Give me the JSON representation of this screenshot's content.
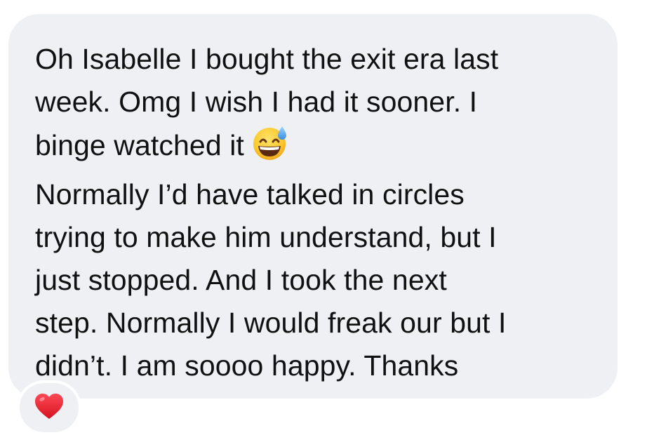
{
  "message": {
    "lines": [
      "Oh Isabelle I bought the exit era last",
      "week. Omg I wish I had it sooner. I",
      "binge watched it",
      "Normally I’d have talked in circles",
      "trying to make him understand, but I",
      "just stopped. And I took the next",
      "step. Normally I would freak our but I",
      "didn’t. I am soooo happy. Thanks"
    ],
    "emoji": "grinning-face-with-sweat-icon"
  },
  "reaction": {
    "icon": "red-heart-icon",
    "color": "#e0202e"
  },
  "colors": {
    "bubble": "#eef0f4",
    "text": "#111111"
  }
}
